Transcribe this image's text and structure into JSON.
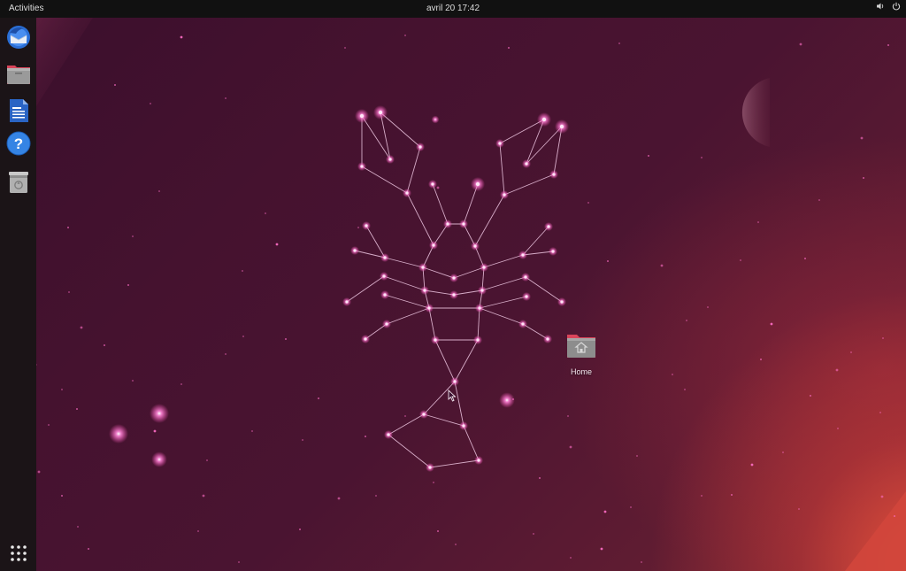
{
  "topbar": {
    "activities_label": "Activities",
    "clock_label": "avril 20  17:42"
  },
  "tray": {
    "items": [
      {
        "name": "volume-icon"
      },
      {
        "name": "power-icon"
      }
    ]
  },
  "dock": {
    "items": [
      {
        "name": "dock-thunderbird",
        "icon": "thunderbird-icon",
        "running": false
      },
      {
        "name": "dock-files",
        "icon": "files-icon",
        "running": false
      },
      {
        "name": "dock-libreoffice-writer",
        "icon": "libreoffice-writer-icon",
        "running": false
      },
      {
        "name": "dock-help",
        "icon": "help-icon",
        "running": false
      },
      {
        "name": "dock-trash",
        "icon": "trash-icon",
        "running": false
      }
    ],
    "show_apps": {
      "icon": "show-applications-icon"
    }
  },
  "desktop": {
    "wallpaper": "constellation-lobster",
    "icons": [
      {
        "label": "Home",
        "icon": "home-folder-icon"
      }
    ]
  },
  "colors": {
    "topbar_bg": "#111111",
    "dock_bg": "#1b1417",
    "accent": "#ff6a3c",
    "star": "#ff7ad1"
  }
}
